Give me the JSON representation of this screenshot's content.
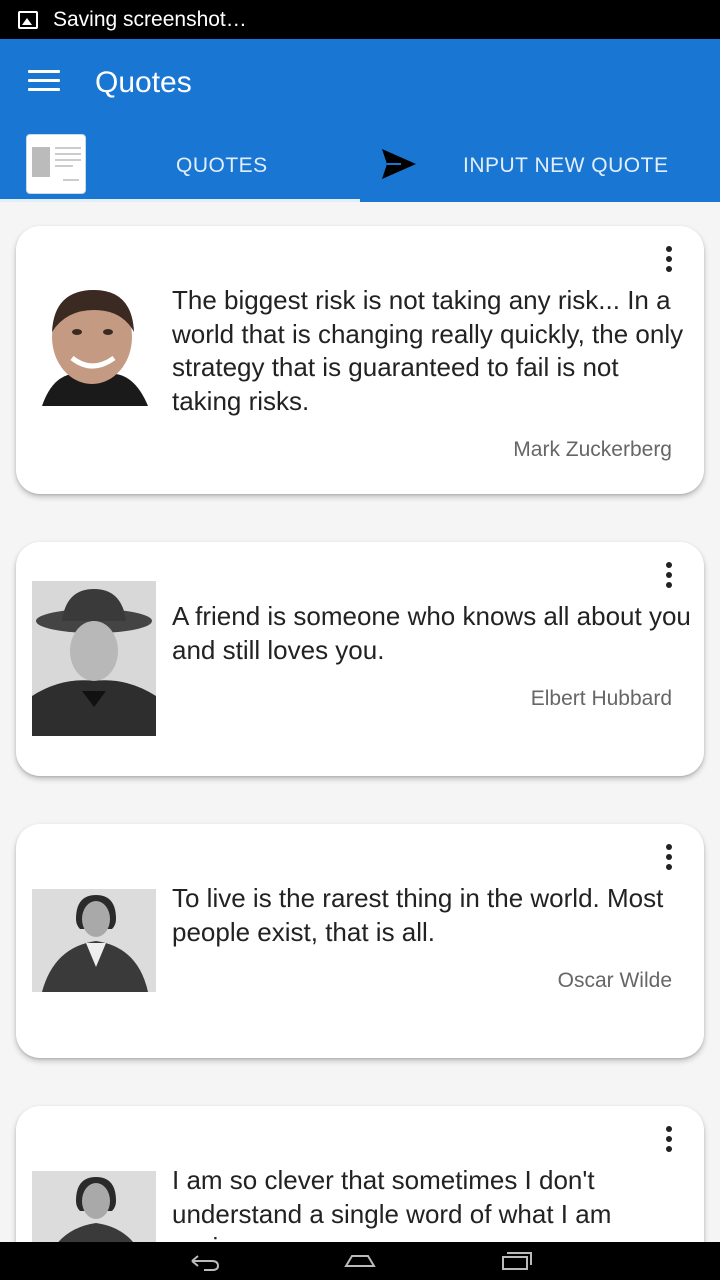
{
  "status_bar": {
    "text": "Saving screenshot…",
    "icon": "image-icon"
  },
  "app_bar": {
    "title": "Quotes",
    "menu_icon": "hamburger-menu-icon"
  },
  "tabs": [
    {
      "label": "QUOTES",
      "icon": "quote-card-icon",
      "selected": true
    },
    {
      "label": "INPUT NEW QUOTE",
      "icon": "send-icon",
      "selected": false
    }
  ],
  "quotes": [
    {
      "text": "The biggest risk is not taking any risk... In a world that is changing really quickly, the only strategy that is guaranteed to fail is not taking risks.",
      "author": "Mark Zuckerberg"
    },
    {
      "text": "A friend is someone who knows all about you and still loves you.",
      "author": "Elbert Hubbard"
    },
    {
      "text": "To live is the rarest thing in the world. Most people exist, that is all.",
      "author": "Oscar Wilde"
    },
    {
      "text": "I am so clever that sometimes I don't understand a single word of what I am saying.",
      "author": ""
    }
  ],
  "colors": {
    "primary": "#1976d2",
    "tab_text": "#e3eefb",
    "background": "#f5f5f5"
  },
  "nav_bar": {
    "buttons": [
      "back-icon",
      "home-icon",
      "recents-icon"
    ]
  }
}
